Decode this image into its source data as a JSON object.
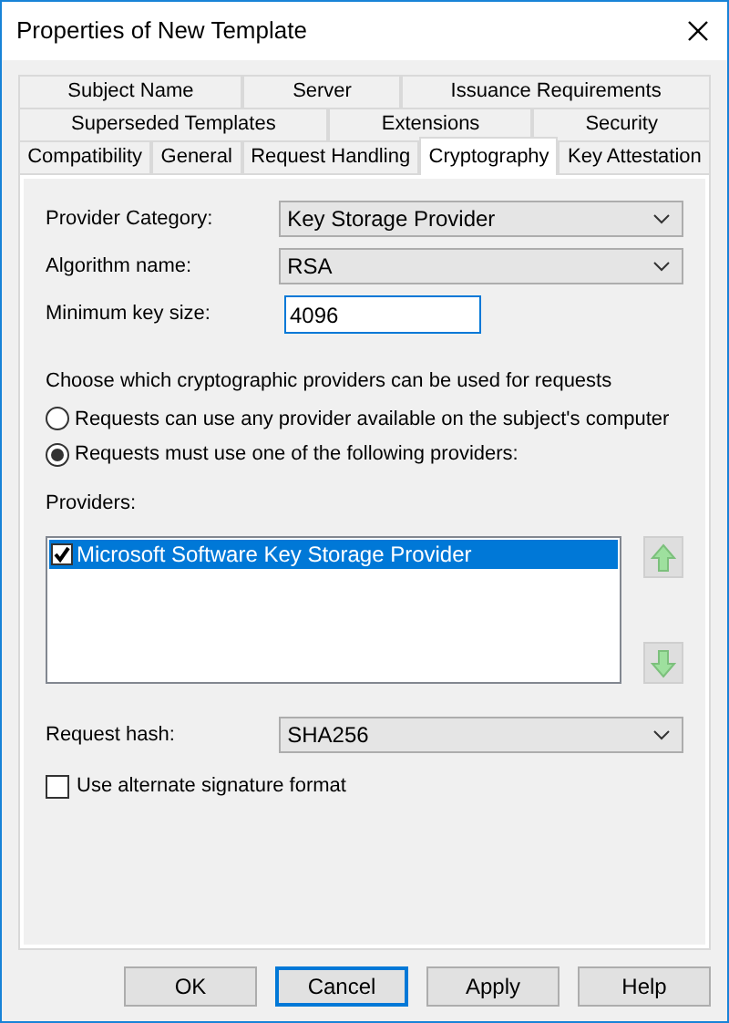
{
  "window": {
    "title": "Properties of New Template"
  },
  "tab_rows": [
    [
      {
        "label": "Subject Name",
        "selected": false
      },
      {
        "label": "Server",
        "selected": false
      },
      {
        "label": "Issuance Requirements",
        "selected": false
      }
    ],
    [
      {
        "label": "Superseded Templates",
        "selected": false
      },
      {
        "label": "Extensions",
        "selected": false
      },
      {
        "label": "Security",
        "selected": false
      }
    ],
    [
      {
        "label": "Compatibility",
        "selected": false
      },
      {
        "label": "General",
        "selected": false
      },
      {
        "label": "Request Handling",
        "selected": false
      },
      {
        "label": "Cryptography",
        "selected": true
      },
      {
        "label": "Key Attestation",
        "selected": false
      }
    ]
  ],
  "fields": [
    {
      "kind": "dropdown",
      "label": "Provider Category:",
      "value": "Key Storage Provider"
    },
    {
      "kind": "dropdown",
      "label": "Algorithm name:",
      "value": "RSA"
    },
    {
      "kind": "input",
      "label": "Minimum key size:",
      "value": "4096"
    }
  ],
  "provider_choice": {
    "prompt": "Choose which cryptographic providers can be used for requests",
    "options": [
      {
        "label": "Requests can use any provider available on the subject's computer",
        "selected": false
      },
      {
        "label": "Requests must use one of the following providers:",
        "selected": true
      }
    ]
  },
  "providers": {
    "label": "Providers:",
    "items": [
      {
        "label": "Microsoft Software Key Storage Provider",
        "checked": true,
        "selected": true
      }
    ]
  },
  "request_hash": {
    "label": "Request hash:",
    "value": "SHA256"
  },
  "alternate_signature": {
    "label": "Use alternate signature format",
    "checked": false
  },
  "buttons": [
    {
      "label": "OK",
      "default": false
    },
    {
      "label": "Cancel",
      "default": true
    },
    {
      "label": "Apply",
      "default": false
    },
    {
      "label": "Help",
      "default": false
    }
  ]
}
